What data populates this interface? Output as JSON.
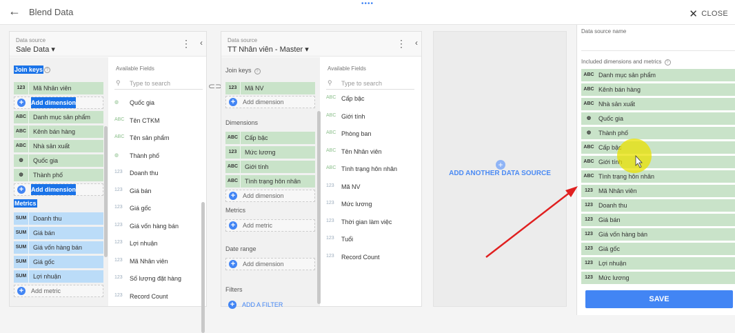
{
  "header": {
    "title": "Blend Data",
    "close_label": "CLOSE"
  },
  "source1": {
    "label": "Data source",
    "name": "Sale Data",
    "join_keys": "Join keys",
    "join": [
      {
        "type": "123",
        "label": "Mã Nhân viên"
      }
    ],
    "add_dimension": "Add dimension",
    "dimensions": [
      {
        "type": "ABC",
        "label": "Danh mục sản phẩm"
      },
      {
        "type": "ABC",
        "label": "Kênh bán hàng"
      },
      {
        "type": "ABC",
        "label": "Nhà sản xuất"
      },
      {
        "type": "geo",
        "label": "Quốc gia"
      },
      {
        "type": "geo",
        "label": "Thành phố"
      }
    ],
    "metrics_label": "Metrics",
    "metrics": [
      {
        "type": "SUM",
        "label": "Doanh thu"
      },
      {
        "type": "SUM",
        "label": "Giá bán"
      },
      {
        "type": "SUM",
        "label": "Giá vốn hàng bán"
      },
      {
        "type": "SUM",
        "label": "Giá gốc"
      },
      {
        "type": "SUM",
        "label": "Lợi nhuận"
      }
    ],
    "add_metric": "Add metric",
    "available_title": "Available Fields",
    "search_placeholder": "Type to search",
    "available": [
      {
        "type": "geo",
        "label": "Quốc gia"
      },
      {
        "type": "ABC",
        "label": "Tên CTKM"
      },
      {
        "type": "ABC",
        "label": "Tên sản phẩm"
      },
      {
        "type": "geo",
        "label": "Thành phố"
      },
      {
        "type": "123",
        "label": "Doanh thu"
      },
      {
        "type": "123",
        "label": "Giá bán"
      },
      {
        "type": "123",
        "label": "Giá gốc"
      },
      {
        "type": "123",
        "label": "Giá vốn hàng bán"
      },
      {
        "type": "123",
        "label": "Lợi nhuận"
      },
      {
        "type": "123",
        "label": "Mã Nhân viên"
      },
      {
        "type": "123",
        "label": "Số lượng đặt hàng"
      },
      {
        "type": "123",
        "label": "Record Count"
      }
    ]
  },
  "source2": {
    "label": "Data source",
    "name": "TT Nhân viên - Master",
    "join_keys": "Join keys",
    "join": [
      {
        "type": "123",
        "label": "Mã NV"
      }
    ],
    "add_dimension": "Add dimension",
    "dimensions_label": "Dimensions",
    "dimensions": [
      {
        "type": "ABC",
        "label": "Cấp bậc"
      },
      {
        "type": "123",
        "label": "Mức lương"
      },
      {
        "type": "ABC",
        "label": "Giới tính"
      },
      {
        "type": "ABC",
        "label": "Tình trạng hôn nhân"
      }
    ],
    "metrics_label": "Metrics",
    "add_metric": "Add metric",
    "date_range_label": "Date range",
    "filters_label": "Filters",
    "add_filter": "ADD A FILTER",
    "available_title": "Available Fields",
    "search_placeholder": "Type to search",
    "available": [
      {
        "type": "ABC",
        "label": "Cấp bậc"
      },
      {
        "type": "ABC",
        "label": "Giới tính"
      },
      {
        "type": "ABC",
        "label": "Phòng ban"
      },
      {
        "type": "ABC",
        "label": "Tên Nhân viên"
      },
      {
        "type": "ABC",
        "label": "Tình trạng hôn nhân"
      },
      {
        "type": "123",
        "label": "Mã NV"
      },
      {
        "type": "123",
        "label": "Mức lương"
      },
      {
        "type": "123",
        "label": "Thời gian làm việc"
      },
      {
        "type": "123",
        "label": "Tuổi"
      },
      {
        "type": "123",
        "label": "Record Count"
      }
    ]
  },
  "add_source_label": "ADD ANOTHER DATA SOURCE",
  "right_panel": {
    "name_label": "Data source name",
    "included_label": "Included dimensions and metrics",
    "save_label": "SAVE",
    "items": [
      {
        "type": "ABC",
        "label": "Danh mục sản phẩm"
      },
      {
        "type": "ABC",
        "label": "Kênh bán hàng"
      },
      {
        "type": "ABC",
        "label": "Nhà sản xuất"
      },
      {
        "type": "geo",
        "label": "Quốc gia"
      },
      {
        "type": "geo",
        "label": "Thành phố"
      },
      {
        "type": "ABC",
        "label": "Cấp bậc"
      },
      {
        "type": "ABC",
        "label": "Giới tính"
      },
      {
        "type": "ABC",
        "label": "Tình trạng hôn nhân"
      },
      {
        "type": "123",
        "label": "Mã Nhân viên"
      },
      {
        "type": "123",
        "label": "Doanh thu"
      },
      {
        "type": "123",
        "label": "Giá bán"
      },
      {
        "type": "123",
        "label": "Giá vốn hàng bán"
      },
      {
        "type": "123",
        "label": "Giá gốc"
      },
      {
        "type": "123",
        "label": "Lợi nhuận"
      },
      {
        "type": "123",
        "label": "Mức lương"
      }
    ]
  },
  "colors": {
    "accent": "#4285f4",
    "dimension": "#c9e3c9",
    "metric": "#bbdcf8",
    "arrow": "#e02020",
    "highlight": "#e8e000"
  }
}
